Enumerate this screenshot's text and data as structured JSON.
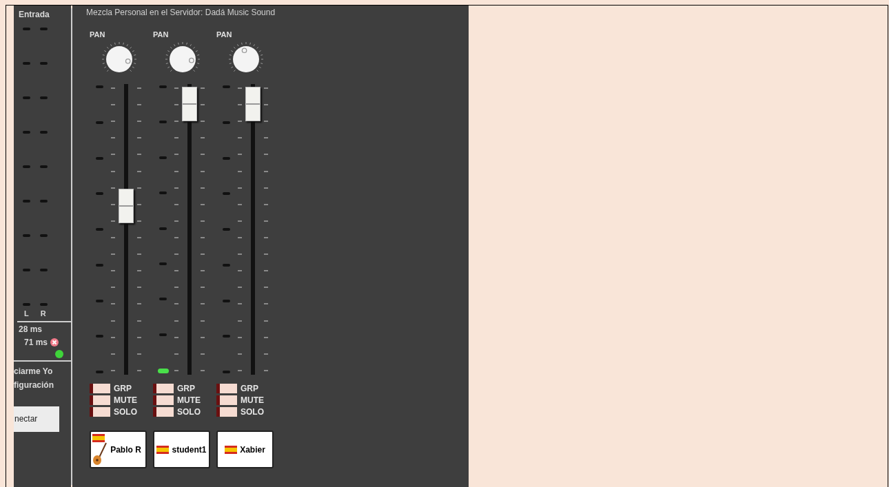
{
  "input_panel": {
    "title": "Entrada",
    "channels": [
      "L",
      "R"
    ],
    "delays": [
      "28 ms",
      "71 ms"
    ],
    "lines": [
      "ciarme Yo",
      "figuración"
    ],
    "button": "nectar"
  },
  "mixer": {
    "title": "Mezcla Personal en el Servidor: Dadá Music Sound",
    "channels": [
      {
        "kind": "guitar",
        "pan_label": "PAN",
        "fader": {
          "level": 0.58
        },
        "signal": false,
        "buttons": [
          {
            "label": "GRP",
            "on": false
          },
          {
            "label": "MUTE",
            "on": false
          },
          {
            "label": "SOLO",
            "on": false
          }
        ],
        "name": "Pablo R"
      },
      {
        "kind": "plain",
        "pan_label": "PAN",
        "fader": {
          "level": 0.95
        },
        "signal": true,
        "buttons": [
          {
            "label": "GRP",
            "on": false
          },
          {
            "label": "MUTE",
            "on": false
          },
          {
            "label": "SOLO",
            "on": false
          }
        ],
        "name": "student1"
      },
      {
        "kind": "plain",
        "pan_label": "PAN",
        "fader": {
          "level": 0.95
        },
        "signal": false,
        "buttons": [
          {
            "label": "GRP",
            "on": false
          },
          {
            "label": "MUTE",
            "on": false
          },
          {
            "label": "SOLO",
            "on": false
          }
        ],
        "name": "Xabier"
      }
    ]
  }
}
